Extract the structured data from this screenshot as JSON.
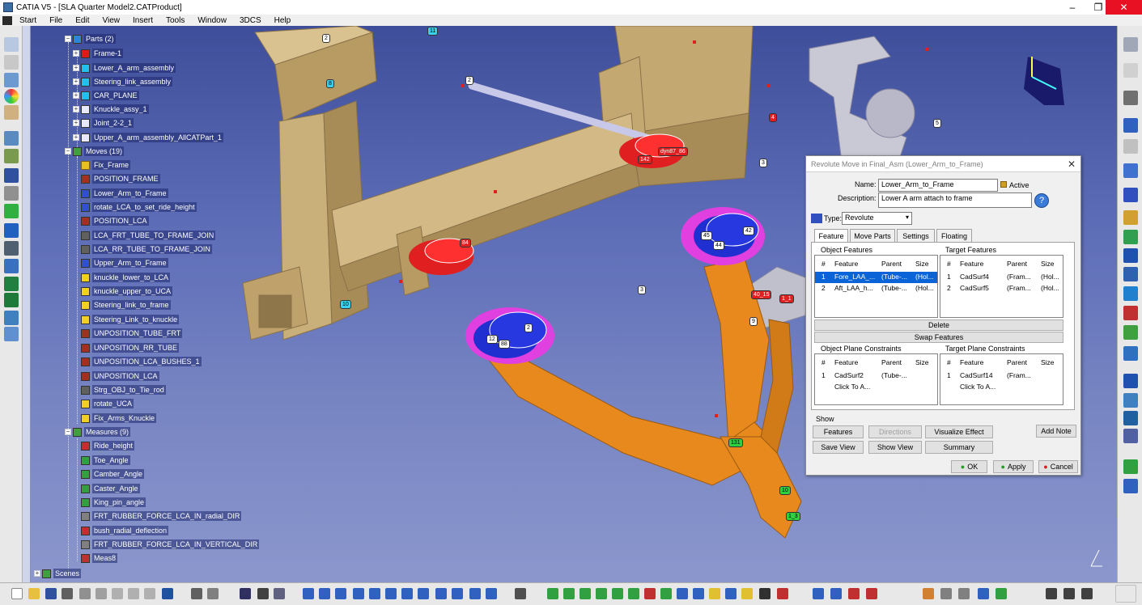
{
  "window": {
    "title": "CATIA V5 - [SLA Quarter Model2.CATProduct]",
    "min": "–",
    "max": "❐",
    "close": "✕"
  },
  "menu": [
    "Start",
    "File",
    "Edit",
    "View",
    "Insert",
    "Tools",
    "Window",
    "3DCS",
    "Help"
  ],
  "tree": {
    "parts": {
      "label": "Parts (2)",
      "items": [
        "Frame-1",
        "Lower_A_arm_assembly",
        "Steering_link_assembly",
        "CAR_PLANE",
        "Knuckle_assy_1",
        "Joint_2-2_1",
        "Upper_A_arm_assembly_AllCATPart_1"
      ]
    },
    "moves": {
      "label": "Moves (19)",
      "items": [
        "Fix_Frame",
        "POSITION_FRAME",
        "Lower_Arm_to_Frame",
        "rotate_LCA_to_set_ride_height",
        "POSITION_LCA",
        "LCA_FRT_TUBE_TO_FRAME_JOIN",
        "LCA_RR_TUBE_TO_FRAME_JOIN",
        "Upper_Arm_to_Frame",
        "knuckle_lower_to_LCA",
        "knuckle_upper_to_UCA",
        "Steering_link_to_frame",
        "Steering_Link_to_knuckle",
        "UNPOSITION_TUBE_FRT",
        "UNPOSITION_RR_TUBE",
        "UNPOSITION_LCA_BUSHES_1",
        "UNPOSITION_LCA",
        "Strg_OBJ_to_Tie_rod",
        "rotate_UCA",
        "Fix_Arms_Knuckle"
      ]
    },
    "measures": {
      "label": "Measures (9)",
      "items": [
        "Ride_height",
        "Toe_Angle",
        "Camber_Angle",
        "Caster_Angle",
        "King_pin_angle",
        "FRT_RUBBER_FORCE_LCA_IN_radial_DIR",
        "bush_radial_deflection",
        "FRT_RUBBER_FORCE_LCA_IN_VERTICAL_DIR",
        "Meas8"
      ]
    },
    "scenes": "Scenes"
  },
  "tags": {
    "t1": "2",
    "t2": "11",
    "t3": "8",
    "t4": "2",
    "t5": "3",
    "t6": "4",
    "t7": "5",
    "t8": "3",
    "t9": "10",
    "t10": "9",
    "t11": "40_15",
    "t12": "1_1",
    "t13": "131",
    "t14": "10",
    "t15": "1_3",
    "t16": "142",
    "t17": "dyn87_86",
    "t18": "44",
    "t19": "45",
    "t20": "42",
    "t21": "84",
    "t22": "88",
    "t23": "12",
    "t24": "2"
  },
  "dialog": {
    "title": "Revolute Move in Final_Asm (Lower_Arm_to_Frame)",
    "name_label": "Name:",
    "name_value": "Lower_Arm_to_Frame",
    "active_label": "Active",
    "description_label": "Description:",
    "description_value": "Lower A arm attach to frame",
    "type_label": "Type:",
    "type_value": "Revolute",
    "tabs": [
      "Feature",
      "Move Parts",
      "Settings",
      "Floating"
    ],
    "object_features": {
      "title": "Object Features",
      "headers": [
        "#",
        "Feature",
        "Parent",
        "Size"
      ],
      "rows": [
        [
          "1",
          "Fore_LAA_...",
          "(Tube-...",
          "(Hol..."
        ],
        [
          "2",
          "Aft_LAA_h...",
          "(Tube-...",
          "(Hol..."
        ]
      ]
    },
    "target_features": {
      "title": "Target Features",
      "headers": [
        "#",
        "Feature",
        "Parent",
        "Size"
      ],
      "rows": [
        [
          "1",
          "CadSurf4",
          "(Fram...",
          "(Hol..."
        ],
        [
          "2",
          "CadSurf5",
          "(Fram...",
          "(Hol..."
        ]
      ]
    },
    "delete_label": "Delete",
    "swap_label": "Swap Features",
    "object_plane": {
      "title": "Object Plane Constraints",
      "headers": [
        "#",
        "Feature",
        "Parent",
        "Size"
      ],
      "rows": [
        [
          "1",
          "CadSurf2",
          "(Tube-...",
          ""
        ],
        [
          "",
          "Click To A...",
          "",
          ""
        ]
      ]
    },
    "target_plane": {
      "title": "Target Plane Constraints",
      "headers": [
        "#",
        "Feature",
        "Parent",
        "Size"
      ],
      "rows": [
        [
          "1",
          "CadSurf14",
          "(Fram...",
          ""
        ],
        [
          "",
          "Click To A...",
          "",
          ""
        ]
      ]
    },
    "show_label": "Show",
    "buttons": {
      "features": "Features",
      "directions": "Directions",
      "visualize": "Visualize Effect",
      "add_note": "Add Note",
      "save_view": "Save View",
      "show_view": "Show View",
      "summary": "Summary",
      "ok": "OK",
      "apply": "Apply",
      "cancel": "Cancel"
    }
  },
  "colors": {
    "viewport_top": "#3f4e9a",
    "frame": "#c9b07a",
    "lca": "#e8891e",
    "selection": "#0a64d8"
  }
}
